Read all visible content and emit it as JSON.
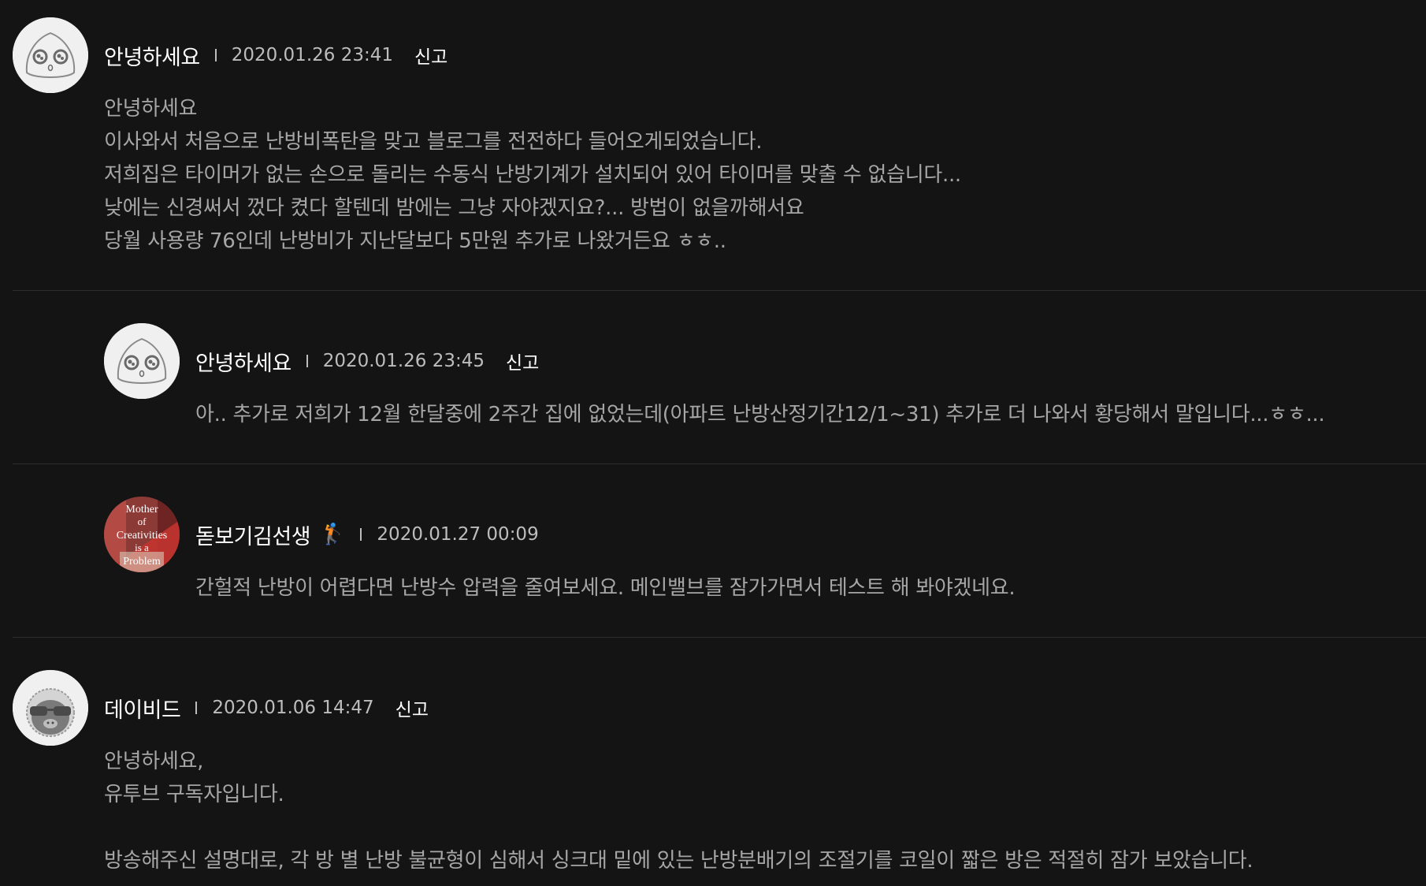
{
  "comments": [
    {
      "author": "안녕하세요",
      "date": "2020.01.26 23:41",
      "report": "신고",
      "avatar_icon": "peach-character-icon",
      "lines": [
        "안녕하세요",
        "이사와서 처음으로 난방비폭탄을 맞고 블로그를 전전하다 들어오게되었습니다.",
        "저희집은 타이머가 없는 손으로 돌리는 수동식 난방기계가 설치되어 있어 타이머를 맞출 수 없습니다...",
        "낮에는 신경써서 껐다 켰다 할텐데 밤에는 그냥 자야겠지요?... 방법이 없을까해서요",
        "당월 사용량 76인데 난방비가 지난달보다 5만원 추가로 나왔거든요 ㅎㅎ.."
      ]
    },
    {
      "author": "안녕하세요",
      "date": "2020.01.26 23:45",
      "report": "신고",
      "avatar_icon": "peach-character-icon",
      "lines": [
        "아.. 추가로 저희가 12월 한달중에 2주간 집에 없었는데(아파트 난방산정기간12/1~31) 추가로 더 나와서 황당해서 말입니다...ㅎㅎ..."
      ]
    },
    {
      "author": "돋보기김선생",
      "badge_icon": "golfer-icon",
      "badge_glyph": "🏌",
      "date": "2020.01.27 00:09",
      "avatar_icon": "profile-photo-icon",
      "avatar_text": [
        "Mother",
        "of",
        "Creativities",
        "is a",
        "Problem"
      ],
      "lines": [
        "간헐적 난방이 어렵다면 난방수 압력을 줄여보세요. 메인밸브를 잠가가면서 테스트 해 봐야겠네요."
      ]
    },
    {
      "author": "데이비드",
      "date": "2020.01.06 14:47",
      "report": "신고",
      "avatar_icon": "sunglasses-character-icon",
      "lines": [
        "안녕하세요,",
        "유투브 구독자입니다.",
        "",
        "방송해주신 설명대로, 각 방 별 난방 불균형이 심해서 싱크대 밑에 있는 난방분배기의 조절기를 코일이 짧은 방은 적절히 잠가 보았습니다."
      ]
    }
  ]
}
